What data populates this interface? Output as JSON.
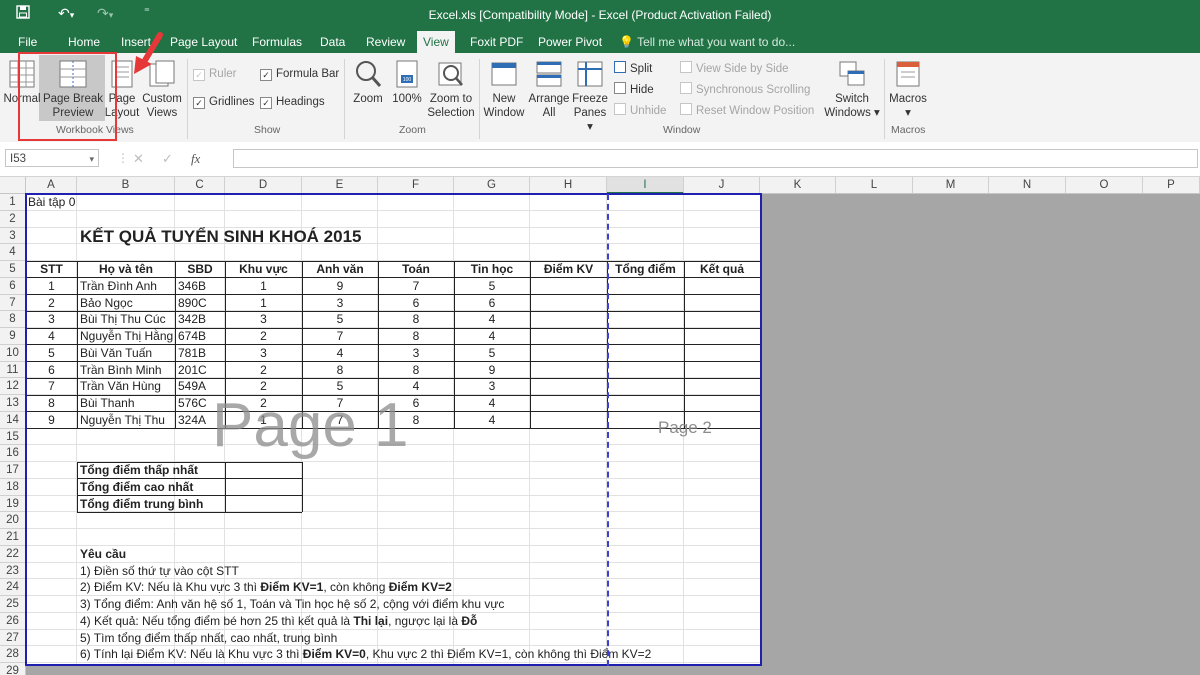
{
  "window": {
    "title": "Excel.xls  [Compatibility Mode] - Excel (Product Activation Failed)"
  },
  "tabs": [
    {
      "label": "File"
    },
    {
      "label": "Home"
    },
    {
      "label": "Insert"
    },
    {
      "label": "Page Layout"
    },
    {
      "label": "Formulas"
    },
    {
      "label": "Data"
    },
    {
      "label": "Review"
    },
    {
      "label": "View"
    },
    {
      "label": "Foxit PDF"
    },
    {
      "label": "Power Pivot"
    }
  ],
  "tell_me": "Tell me what you want to do...",
  "ribbon": {
    "workbook_views": {
      "label": "Workbook Views",
      "normal": "Normal",
      "page_break": "Page Break",
      "page_break2": "Preview",
      "page_layout": "Page",
      "page_layout2": "Layout",
      "custom_views": "Custom",
      "custom_views2": "Views"
    },
    "show": {
      "label": "Show",
      "ruler": "Ruler",
      "formula_bar": "Formula Bar",
      "gridlines": "Gridlines",
      "headings": "Headings"
    },
    "zoom": {
      "label": "Zoom",
      "zoom": "Zoom",
      "hundred": "100%",
      "zoom_sel": "Zoom to",
      "zoom_sel2": "Selection"
    },
    "window": {
      "label": "Window",
      "new_window": "New",
      "new_window2": "Window",
      "arrange": "Arrange",
      "arrange2": "All",
      "freeze": "Freeze",
      "freeze2": "Panes ▾",
      "split": "Split",
      "hide": "Hide",
      "unhide": "Unhide",
      "side_by_side": "View Side by Side",
      "sync_scroll": "Synchronous Scrolling",
      "reset_pos": "Reset Window Position",
      "switch": "Switch",
      "switch2": "Windows ▾"
    },
    "macros": {
      "label": "Macros",
      "macros": "Macros",
      "macros2": "▾"
    }
  },
  "formula_bar": {
    "name_box": "I53",
    "formula": ""
  },
  "columns": [
    "A",
    "B",
    "C",
    "D",
    "E",
    "F",
    "G",
    "H",
    "I",
    "J",
    "K",
    "L",
    "M",
    "N",
    "O",
    "P"
  ],
  "rows": [
    "1",
    "2",
    "3",
    "4",
    "5",
    "6",
    "7",
    "8",
    "9",
    "10",
    "11",
    "12",
    "13",
    "14",
    "15",
    "16",
    "17",
    "18",
    "19",
    "20",
    "21",
    "22",
    "23",
    "24",
    "25",
    "26",
    "27",
    "28",
    "29"
  ],
  "sheet": {
    "a1": "Bài tập 0",
    "title": "KẾT QUẢ TUYỂN SINH KHOÁ 2015",
    "headers": [
      "STT",
      "Họ và tên",
      "SBD",
      "Khu vực",
      "Anh văn",
      "Toán",
      "Tin học",
      "Điểm KV",
      "Tổng điểm",
      "Kết quả"
    ],
    "students": [
      [
        "1",
        "Trần Đình Anh",
        "346B",
        "1",
        "9",
        "7",
        "5"
      ],
      [
        "2",
        "Bảo Ngọc",
        "890C",
        "1",
        "3",
        "6",
        "6"
      ],
      [
        "3",
        "Bùi Thị Thu Cúc",
        "342B",
        "3",
        "5",
        "8",
        "4"
      ],
      [
        "4",
        "Nguyễn Thị Hằng",
        "674B",
        "2",
        "7",
        "8",
        "4"
      ],
      [
        "5",
        "Bùi Văn Tuấn",
        "781B",
        "3",
        "4",
        "3",
        "5"
      ],
      [
        "6",
        "Trần Bình Minh",
        "201C",
        "2",
        "8",
        "8",
        "9"
      ],
      [
        "7",
        "Trần Văn Hùng",
        "549A",
        "2",
        "5",
        "4",
        "3"
      ],
      [
        "8",
        "Bùi Thanh",
        "576C",
        "2",
        "7",
        "6",
        "4"
      ],
      [
        "9",
        "Nguyễn Thị Thu",
        "324A",
        "1",
        "7",
        "8",
        "4"
      ]
    ],
    "summary": [
      "Tổng điểm thấp nhất",
      "Tổng điểm cao nhất",
      "Tổng điểm trung bình"
    ],
    "req_title": "Yêu cầu",
    "req1": "1) Điền số thứ tự vào cột STT",
    "req2": {
      "a": "2) Điểm KV: Nếu là Khu vực 3 thì ",
      "b": "Điểm KV=1",
      "c": ", còn không ",
      "d": "Điểm KV=2"
    },
    "req3": "3) Tổng điểm: Anh văn hệ số 1, Toán và Tin học hệ số 2, cộng với điểm khu vực",
    "req4": {
      "a": "4) Kết quả: Nếu tổng điểm bé hơn 25 thì kết quả là ",
      "b": "Thi lại",
      "c": ", ngược lại là ",
      "d": "Đỗ"
    },
    "req5": "5) Tìm tổng điểm thấp nhất, cao nhất, trung bình",
    "req6": {
      "a": "6) Tính lại Điểm KV: Nếu là Khu vực 3 thì ",
      "b": "Điểm KV=0",
      "c": ", Khu vực 2 thì Điểm KV=1, còn không thì Điểm KV=2"
    },
    "page1": "Page 1",
    "page2": "Page 2"
  },
  "colors": {
    "excel_green": "#217346",
    "page_border": "#1f1fb0",
    "highlight_red": "#e63838"
  }
}
